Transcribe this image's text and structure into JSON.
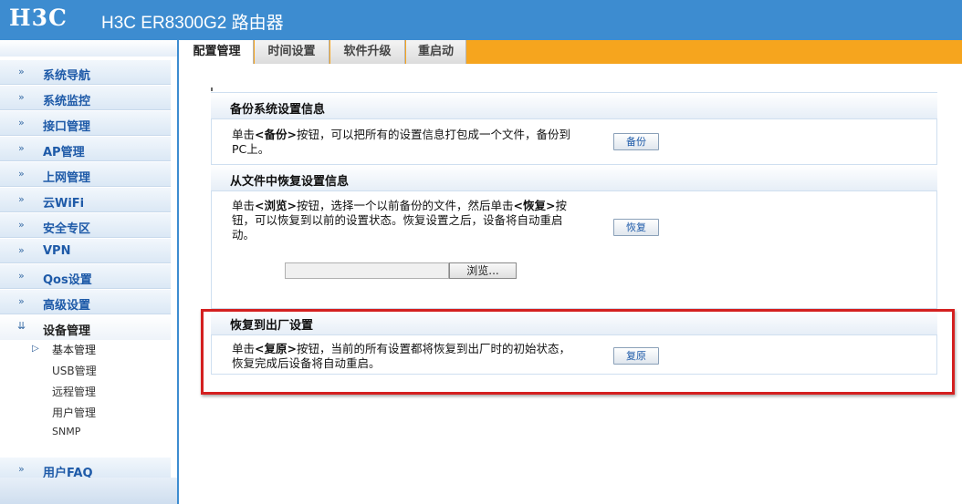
{
  "header": {
    "logo": "H3C",
    "product_title": "H3C ER8300G2 路由器",
    "bar_color": "#3d8cd0"
  },
  "sidebar": {
    "items": [
      {
        "label": "系统导航",
        "icon": "double-chevron-right-icon"
      },
      {
        "label": "系统监控",
        "icon": "double-chevron-right-icon"
      },
      {
        "label": "接口管理",
        "icon": "double-chevron-right-icon"
      },
      {
        "label": "AP管理",
        "icon": "double-chevron-right-icon"
      },
      {
        "label": "上网管理",
        "icon": "double-chevron-right-icon"
      },
      {
        "label": "云WiFi",
        "icon": "double-chevron-right-icon"
      },
      {
        "label": "安全专区",
        "icon": "double-chevron-right-icon"
      },
      {
        "label": "VPN",
        "icon": "double-chevron-right-icon"
      },
      {
        "label": "Qos设置",
        "icon": "double-chevron-right-icon"
      },
      {
        "label": "高级设置",
        "icon": "double-chevron-right-icon"
      },
      {
        "label": "设备管理",
        "icon": "double-chevron-down-icon",
        "expanded": true
      }
    ],
    "sub_items": [
      {
        "label": "基本管理",
        "active": true
      },
      {
        "label": "USB管理"
      },
      {
        "label": "远程管理"
      },
      {
        "label": "用户管理"
      },
      {
        "label": "SNMP"
      }
    ],
    "bottom_item": {
      "label": "用户FAQ",
      "icon": "double-chevron-right-icon"
    }
  },
  "tabs": [
    {
      "label": "配置管理",
      "active": true
    },
    {
      "label": "时间设置"
    },
    {
      "label": "软件升级"
    },
    {
      "label": "重启动"
    }
  ],
  "tabbar_color": "#f6a51e",
  "sections": {
    "backup": {
      "title": "备份系统设置信息",
      "desc_pre": "单击",
      "desc_key": "<备份>",
      "desc_post": "按钮，可以把所有的设置信息打包成一个文件，备份到PC上。",
      "button": "备份"
    },
    "restore": {
      "title": "从文件中恢复设置信息",
      "desc_pre": "单击",
      "desc_key1": "<浏览>",
      "desc_mid": "按钮，选择一个以前备份的文件，然后单击",
      "desc_key2": "<恢复>",
      "desc_post": "按钮，可以恢复到以前的设置状态。恢复设置之后，设备将自动重启动。",
      "browse_button": "浏览...",
      "file_value": "",
      "button": "恢复"
    },
    "factory": {
      "title": "恢复到出厂设置",
      "desc_pre": "单击",
      "desc_key": "<复原>",
      "desc_post": "按钮，当前的所有设置都将恢复到出厂时的初始状态，恢复完成后设备将自动重启。",
      "button": "复原"
    }
  },
  "highlight_color": "#d42020"
}
